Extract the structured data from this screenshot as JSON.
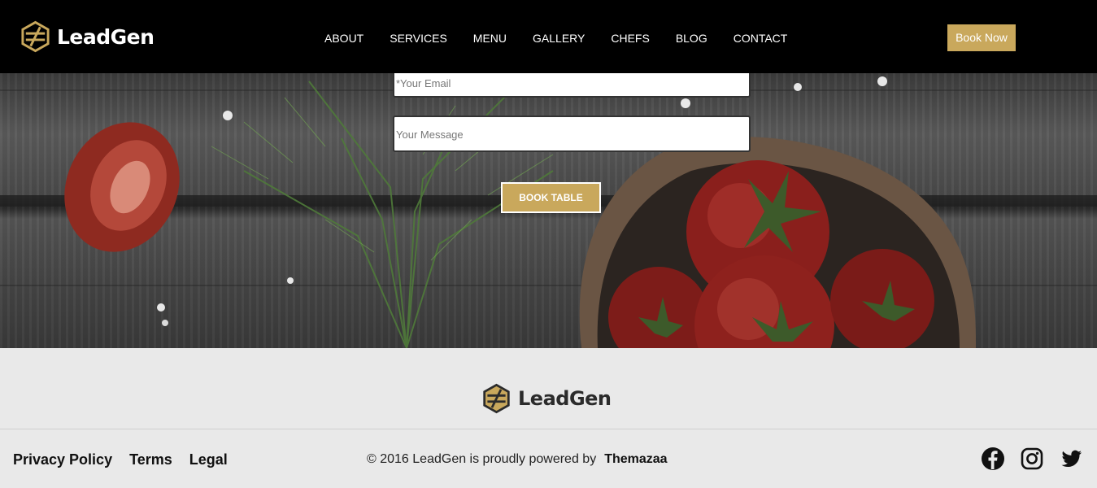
{
  "header": {
    "brand": "LeadGen",
    "nav": [
      "ABOUT",
      "SERVICES",
      "MENU",
      "GALLERY",
      "CHEFS",
      "BLOG",
      "CONTACT"
    ],
    "cta_label": "Book Now"
  },
  "form": {
    "email_placeholder": "*Your Email",
    "message_placeholder": "Your Message",
    "submit_label": "BOOK TABLE"
  },
  "footer": {
    "brand": "LeadGen",
    "legal_links": [
      "Privacy Policy",
      "Terms",
      "Legal"
    ],
    "copyright": "© 2016 LeadGen is proudly powered by",
    "powered_by": "Themazaa",
    "social": [
      "facebook-icon",
      "instagram-icon",
      "twitter-icon"
    ]
  },
  "colors": {
    "accent": "#c9a85c",
    "header_bg": "#000000",
    "footer_bg": "#e9e9e9"
  }
}
